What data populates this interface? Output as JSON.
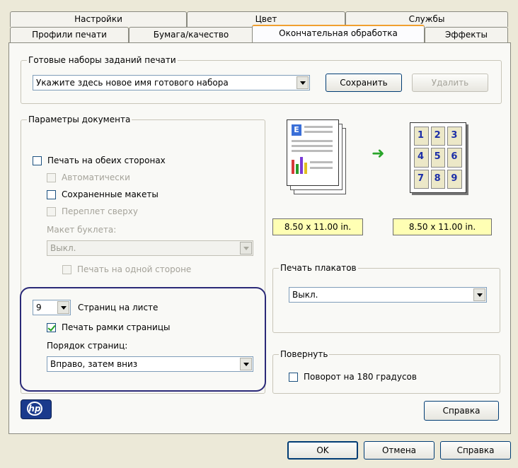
{
  "tabs_back": [
    "Настройки",
    "Цвет",
    "Службы"
  ],
  "tabs_front": [
    "Профили печати",
    "Бумага/качество",
    "Окончательная обработка",
    "Эффекты"
  ],
  "presets": {
    "legend": "Готовые наборы заданий печати",
    "value": "Укажите здесь новое имя готового набора",
    "save_label": "Сохранить",
    "delete_label": "Удалить"
  },
  "doc": {
    "legend": "Параметры документа",
    "both_sides": "Печать на обеих сторонах",
    "auto": "Автоматически",
    "saved_layouts": "Сохраненные макеты",
    "flip_up": "Переплет сверху",
    "booklet_label": "Макет буклета:",
    "booklet_value": "Выкл.",
    "one_side": "Печать на одной стороне"
  },
  "pages": {
    "per_sheet_value": "9",
    "per_sheet_label": "Страниц на листе",
    "borders_label": "Печать рамки страницы",
    "order_label": "Порядок страниц:",
    "order_value": "Вправо, затем вниз"
  },
  "preview": {
    "size_left": "8.50 x 11.00 in.",
    "size_right": "8.50 x 11.00 in.",
    "arrow_color": "#2aa52a",
    "page_numbers": [
      "1",
      "2",
      "3",
      "4",
      "5",
      "6",
      "7",
      "8",
      "9"
    ]
  },
  "poster": {
    "legend": "Печать плакатов",
    "value": "Выкл."
  },
  "rotate": {
    "legend": "Повернуть",
    "label": "Поворот на 180 градусов"
  },
  "logo": {
    "text": "hp",
    "color": "#1a3a8c"
  },
  "help_label": "Справка",
  "footer": {
    "ok": "OK",
    "cancel": "Отмена",
    "help": "Справка"
  },
  "accent_highlight": "#2b2a78"
}
